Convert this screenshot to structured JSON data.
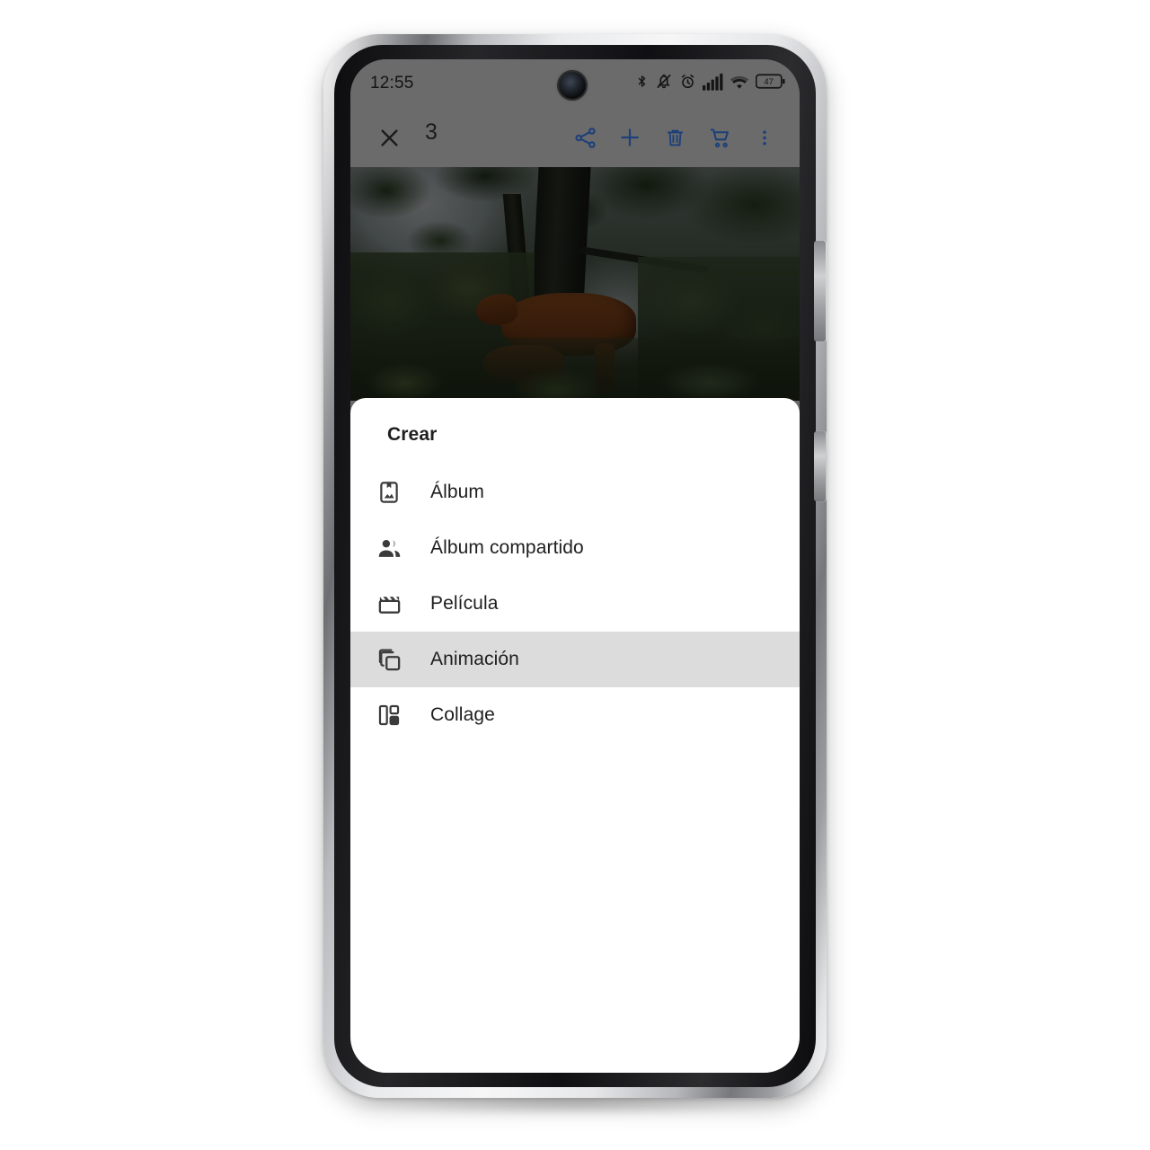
{
  "status_bar": {
    "time": "12:55",
    "battery_level": "47",
    "icons": [
      "bluetooth-icon",
      "mute-bell-icon",
      "alarm-clock-icon",
      "signal-bars-icon",
      "wifi-icon",
      "battery-icon"
    ]
  },
  "toolbar": {
    "close_label": "×",
    "selection_count": "3",
    "actions": [
      {
        "name": "share-button",
        "icon": "share-icon"
      },
      {
        "name": "add-button",
        "icon": "plus-icon"
      },
      {
        "name": "delete-button",
        "icon": "trash-icon"
      },
      {
        "name": "cart-button",
        "icon": "shopping-cart-icon"
      },
      {
        "name": "overflow-button",
        "icon": "more-vertical-icon"
      }
    ],
    "accent_color": "#1d3f7a"
  },
  "photo": {
    "alt": "Brown highland cattle grazing in front of a large tree in a forest"
  },
  "sheet": {
    "title": "Crear",
    "items": [
      {
        "label": "Álbum",
        "icon": "album-icon",
        "selected": false
      },
      {
        "label": "Álbum compartido",
        "icon": "people-icon",
        "selected": false
      },
      {
        "label": "Película",
        "icon": "movie-clapper-icon",
        "selected": false
      },
      {
        "label": "Animación",
        "icon": "layers-icon",
        "selected": true
      },
      {
        "label": "Collage",
        "icon": "collage-icon",
        "selected": false
      }
    ],
    "highlight_color": "#dcdcdc",
    "background_color": "#ffffff"
  }
}
